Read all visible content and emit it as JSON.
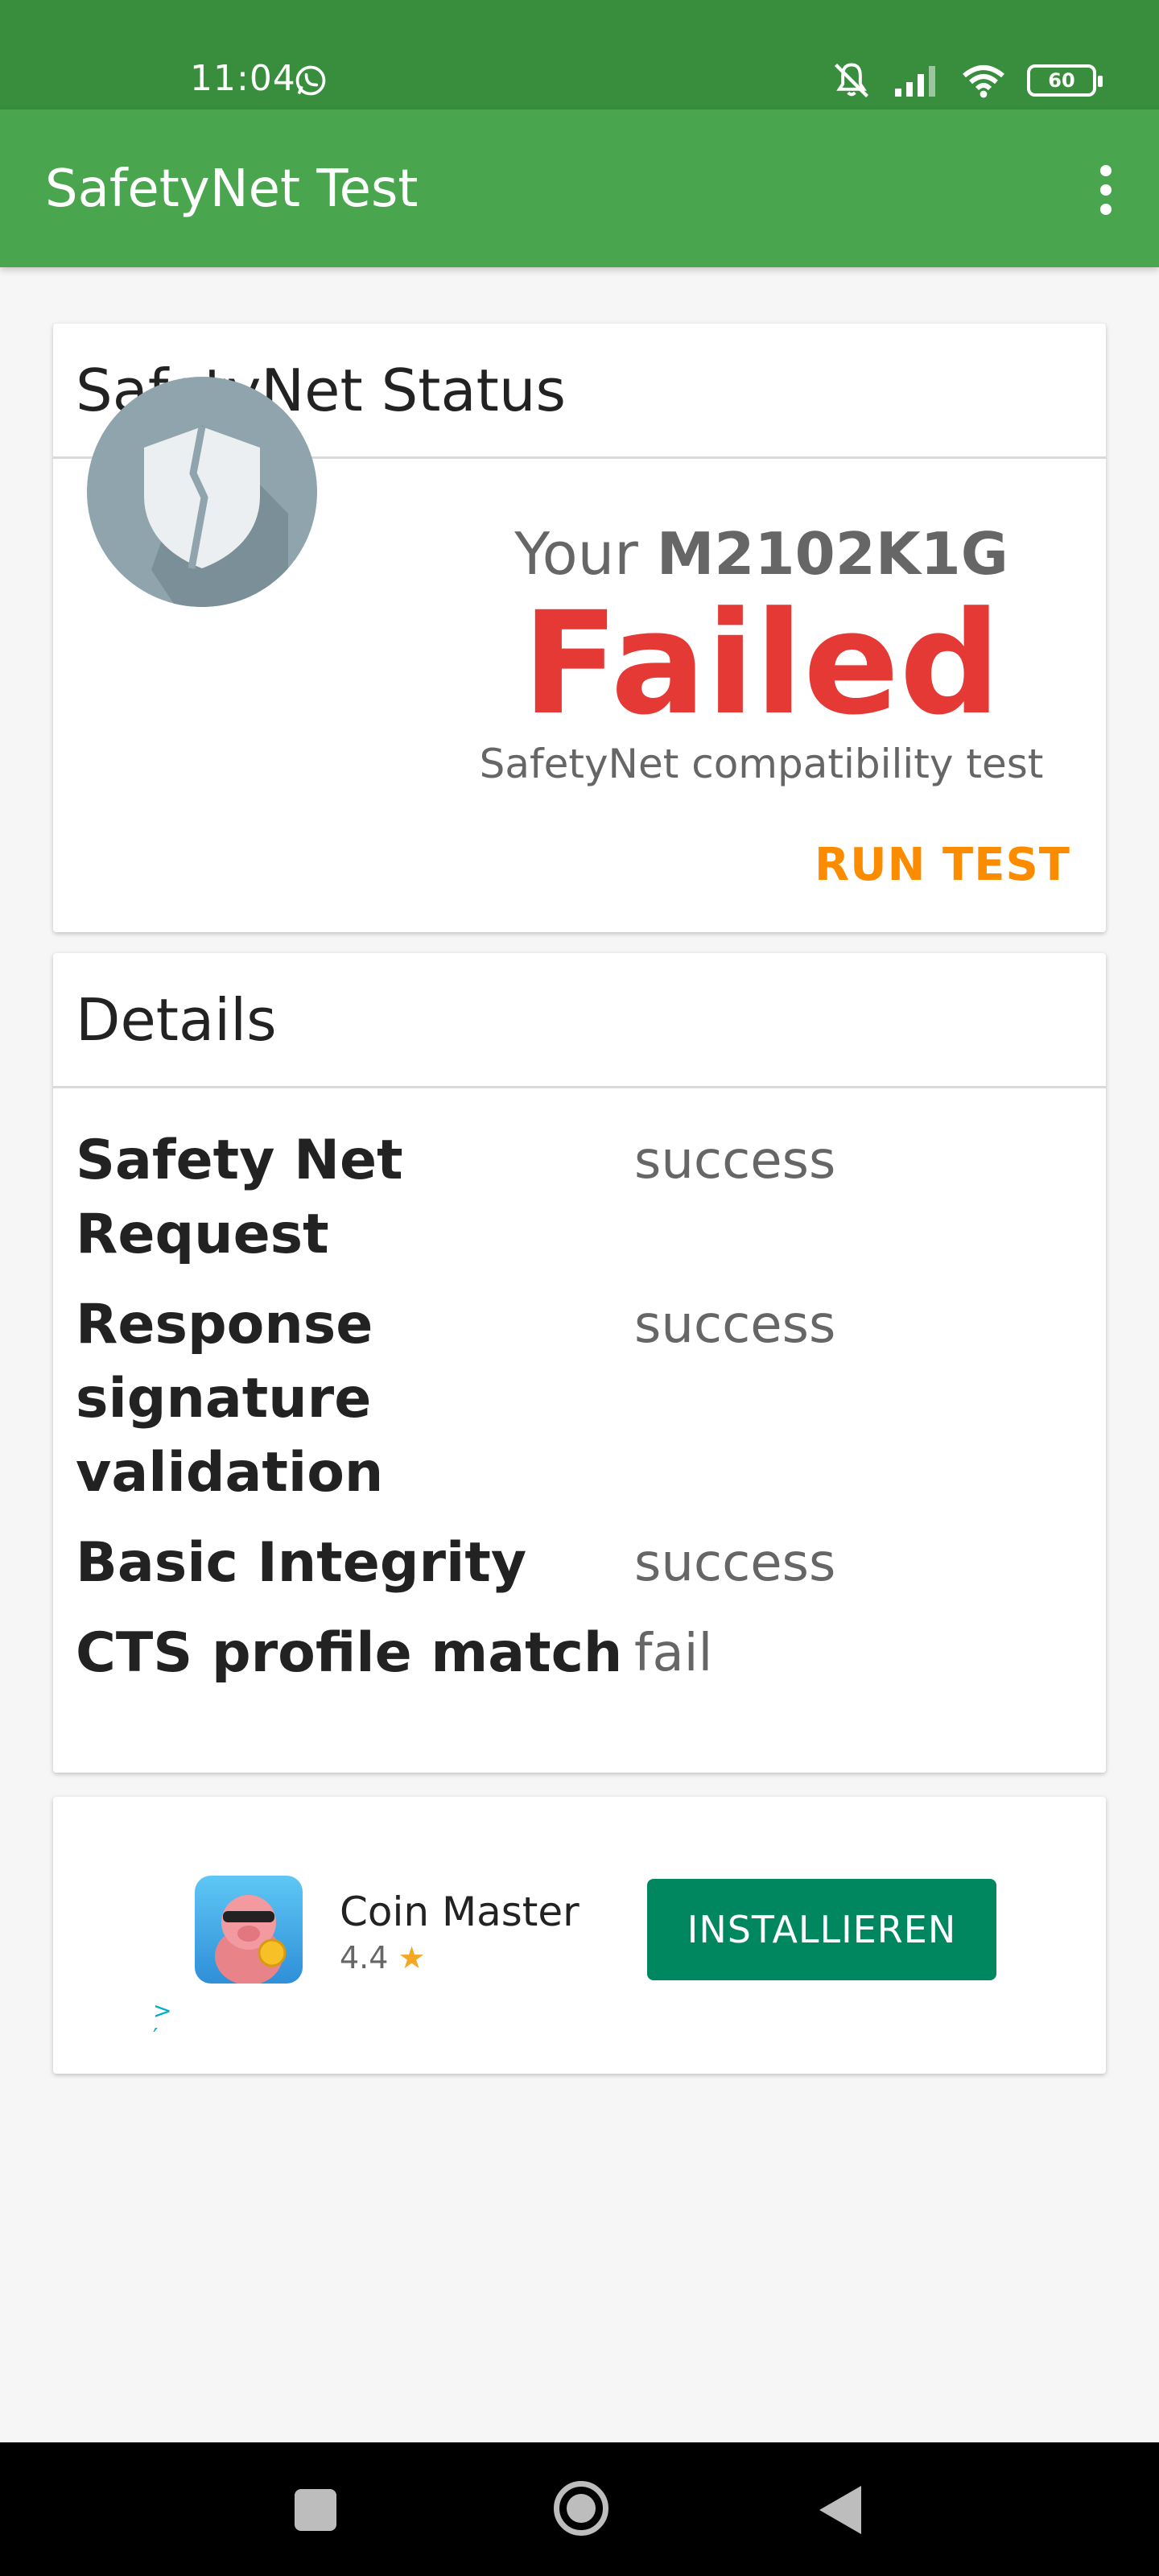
{
  "status_bar": {
    "time": "11:04",
    "battery": "60"
  },
  "app_bar": {
    "title": "SafetyNet Test"
  },
  "status_card": {
    "header": "SafetyNet Status",
    "device_prefix": "Your",
    "device_model": "M2102K1G",
    "result": "Failed",
    "subtitle": "SafetyNet compatibility test",
    "run_test_label": "RUN TEST",
    "result_color": "#e53935",
    "accent_color": "#fb8c00"
  },
  "details_card": {
    "header": "Details",
    "rows": [
      {
        "label": "Safety Net Request",
        "value": "success"
      },
      {
        "label": "Response signature validation",
        "value": "success"
      },
      {
        "label": "Basic Integrity",
        "value": "success"
      },
      {
        "label": "CTS profile match",
        "value": "fail"
      }
    ]
  },
  "ad": {
    "app_name": "Coin Master",
    "rating": "4.4",
    "install_label": "INSTALLIEREN",
    "button_color": "#01875f"
  },
  "theme": {
    "primary": "#4aa64e",
    "primary_dark": "#388e3c"
  }
}
